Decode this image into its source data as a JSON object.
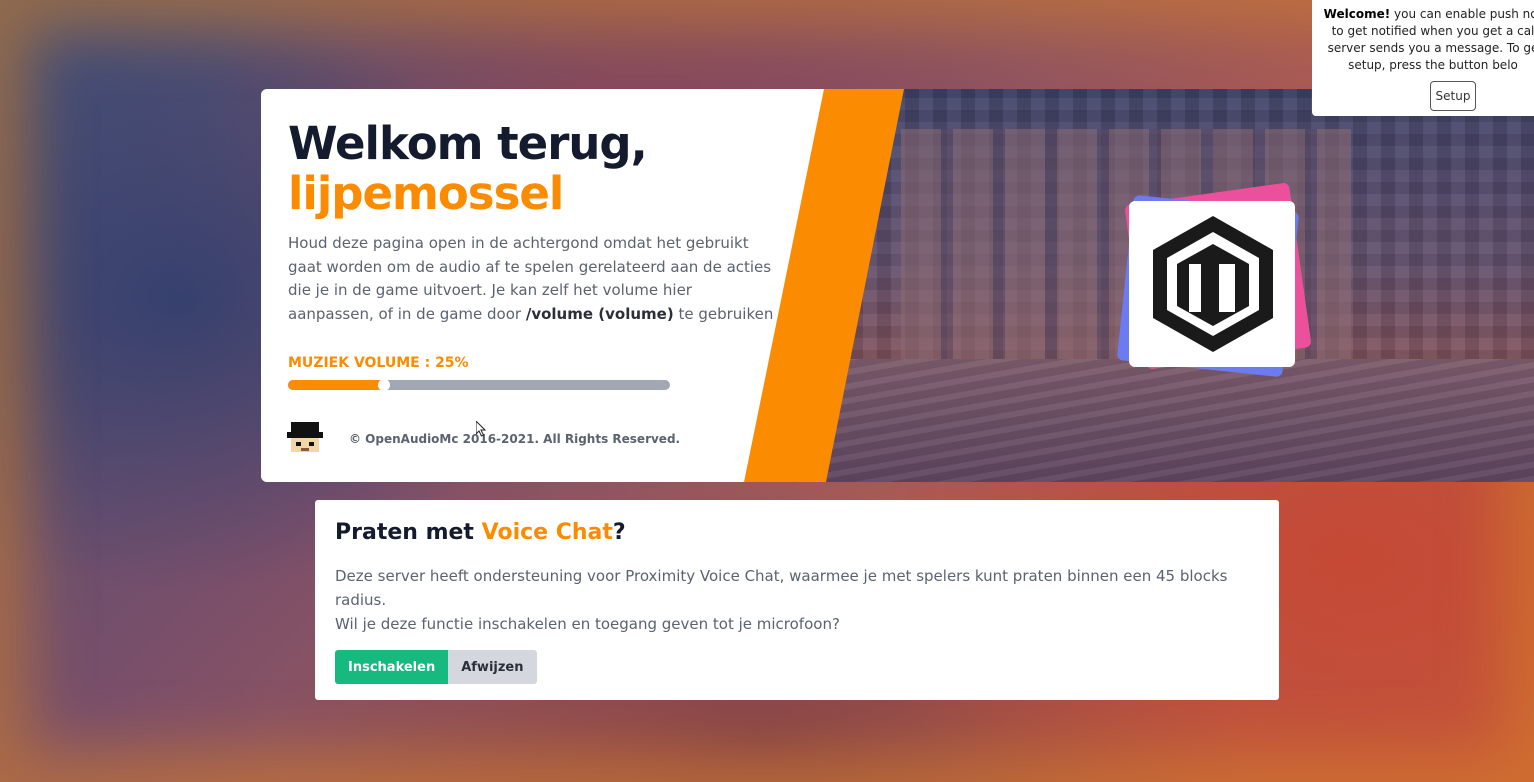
{
  "hero": {
    "welcome": "Welkom terug,",
    "username": "lijpemossel",
    "description_before": "Houd deze pagina open in de achtergond omdat het gebruikt gaat worden om de audio af te spelen gerelateerd aan de acties die je in de game uitvoert. Je kan zelf het volume hier aanpassen, of in de game door",
    "description_command": "/volume (volume)",
    "description_after": "te gebruiken",
    "volume_label": "MUZIEK VOLUME : 25%",
    "volume_percent": 25,
    "copyright": "© OpenAudioMc 2016-2021. All Rights Reserved."
  },
  "voice_chat": {
    "title_prefix": "Praten met",
    "title_accent": "Voice Chat",
    "title_suffix": "?",
    "description_line1": "Deze server heeft ondersteuning voor Proximity Voice Chat, waarmee je met spelers kunt praten binnen een 45 blocks radius.",
    "description_line2": "Wil je deze functie inschakelen en toegang geven tot je microfoon?",
    "enable_label": "Inschakelen",
    "decline_label": "Afwijzen"
  },
  "notification": {
    "bold": "Welcome!",
    "line1_rest": "you can enable push not",
    "line2": "to get notified when you get a cal",
    "line3": "server sends you a message. To ge",
    "line4": "setup, press the button belo",
    "setup_label": "Setup"
  },
  "colors": {
    "accent": "#fb8b00",
    "dark": "#141b2e",
    "enable": "#16b97e"
  },
  "icons": [
    "openaudiomc-logo-icon",
    "player-avatar-icon",
    "mouse-cursor-icon"
  ]
}
